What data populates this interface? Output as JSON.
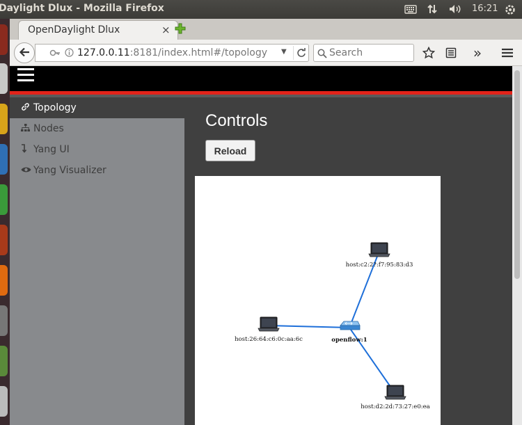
{
  "os": {
    "window_title": "Daylight Dlux - Mozilla Firefox",
    "clock": "16:21",
    "icons": [
      "keyboard-icon",
      "network-arrows-icon",
      "volume-icon",
      "power-gear-icon"
    ]
  },
  "browser": {
    "tab_title": "OpenDaylight Dlux",
    "tab_close": "×",
    "url_host": "127.0.0.11",
    "url_path": ":8181/index.html#/topology",
    "search_placeholder": "Search",
    "toolbar_icons": [
      "back-icon",
      "identity-icon",
      "info-icon",
      "dropdown-icon",
      "reload-icon",
      "search-icon",
      "bookmark-star-icon",
      "reader-list-icon",
      "overflow-icon",
      "hamburger-menu-icon"
    ]
  },
  "app": {
    "sidebar": {
      "items": [
        {
          "label": "Topology",
          "icon": "link-icon",
          "glyph": "🔗",
          "active": true
        },
        {
          "label": "Nodes",
          "icon": "sitemap-icon",
          "glyph": "⛬",
          "active": false
        },
        {
          "label": "Yang UI",
          "icon": "level-down-icon",
          "glyph": "↴",
          "active": false
        },
        {
          "label": "Yang Visualizer",
          "icon": "eye-icon",
          "glyph": "👁",
          "active": false
        }
      ]
    },
    "controls": {
      "title": "Controls",
      "reload_label": "Reload"
    },
    "topology": {
      "nodes": [
        {
          "id": "switch",
          "label": "openflow:1",
          "kind": "switch"
        },
        {
          "id": "h1",
          "label": "host:c2:2?:f7:95:83:d3",
          "kind": "host"
        },
        {
          "id": "h2",
          "label": "host:26:64:c6:0c:aa:6c",
          "kind": "host"
        },
        {
          "id": "h3",
          "label": "host:d2:2d:73:27:e0:ea",
          "kind": "host"
        }
      ],
      "links": [
        [
          "switch",
          "h1"
        ],
        [
          "switch",
          "h2"
        ],
        [
          "switch",
          "h3"
        ]
      ],
      "link_color": "#1e6fd9"
    }
  },
  "colors": {
    "header": "#000000",
    "accent_bar": "#e2231a",
    "sidebar": "#888a8d",
    "content_bg": "#404040"
  }
}
